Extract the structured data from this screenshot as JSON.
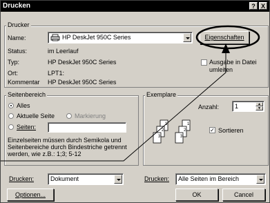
{
  "window": {
    "title": "Drucken",
    "help_btn": "?",
    "close_btn": "X"
  },
  "printer": {
    "group_label": "Drucker",
    "name_label": "Name:",
    "name_value": "HP DeskJet 950C Series",
    "properties_button": "Eigenschaften",
    "status_label": "Status:",
    "status_value": "im Leerlauf",
    "type_label": "Typ:",
    "type_value": "HP DeskJet 950C Series",
    "location_label": "Ort:",
    "location_value": "LPT1:",
    "comment_label": "Kommentar",
    "comment_value": "HP DeskJet 950C Series",
    "print_to_file_line1": "Ausgabe in Datei",
    "print_to_file_line2": "umleiten"
  },
  "range": {
    "group_label": "Seitenbereich",
    "all": "Alles",
    "current": "Aktuelle Seite",
    "selection": "Markierung",
    "pages": "Seiten:",
    "pages_value": "",
    "hint_line1": "Einzelseiten müssen durch Semikola und",
    "hint_line2": "Seitenbereiche durch Bindestriche getrennt",
    "hint_line3": "werden, wie z.B.: 1;3; 5-12"
  },
  "copies": {
    "group_label": "Exemplare",
    "count_label": "Anzahl:",
    "count_value": "1",
    "collate": "Sortieren",
    "page_icon_labels": [
      "1",
      "2",
      "3",
      "1",
      "2",
      "3"
    ]
  },
  "bottom": {
    "print_what_label": "Drucken:",
    "print_what_value": "Dokument",
    "print_label": "Drucken:",
    "print_value": "Alle Seiten im Bereich",
    "options_button": "Optionen...",
    "ok_button": "OK",
    "cancel_button": "Cancel"
  }
}
